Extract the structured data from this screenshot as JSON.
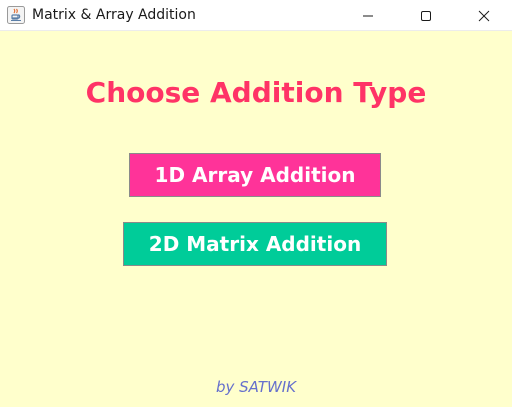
{
  "window": {
    "title": "Matrix & Array Addition",
    "icon": "java-icon"
  },
  "main": {
    "heading": "Choose Addition Type",
    "button_1d_label": "1D Array Addition",
    "button_2d_label": "2D Matrix Addition",
    "credit": "by SATWIK"
  },
  "colors": {
    "background": "#ffffcc",
    "heading": "#ff3366",
    "button_1d": "#ff3399",
    "button_2d": "#00cc99",
    "credit": "#6670cc"
  }
}
